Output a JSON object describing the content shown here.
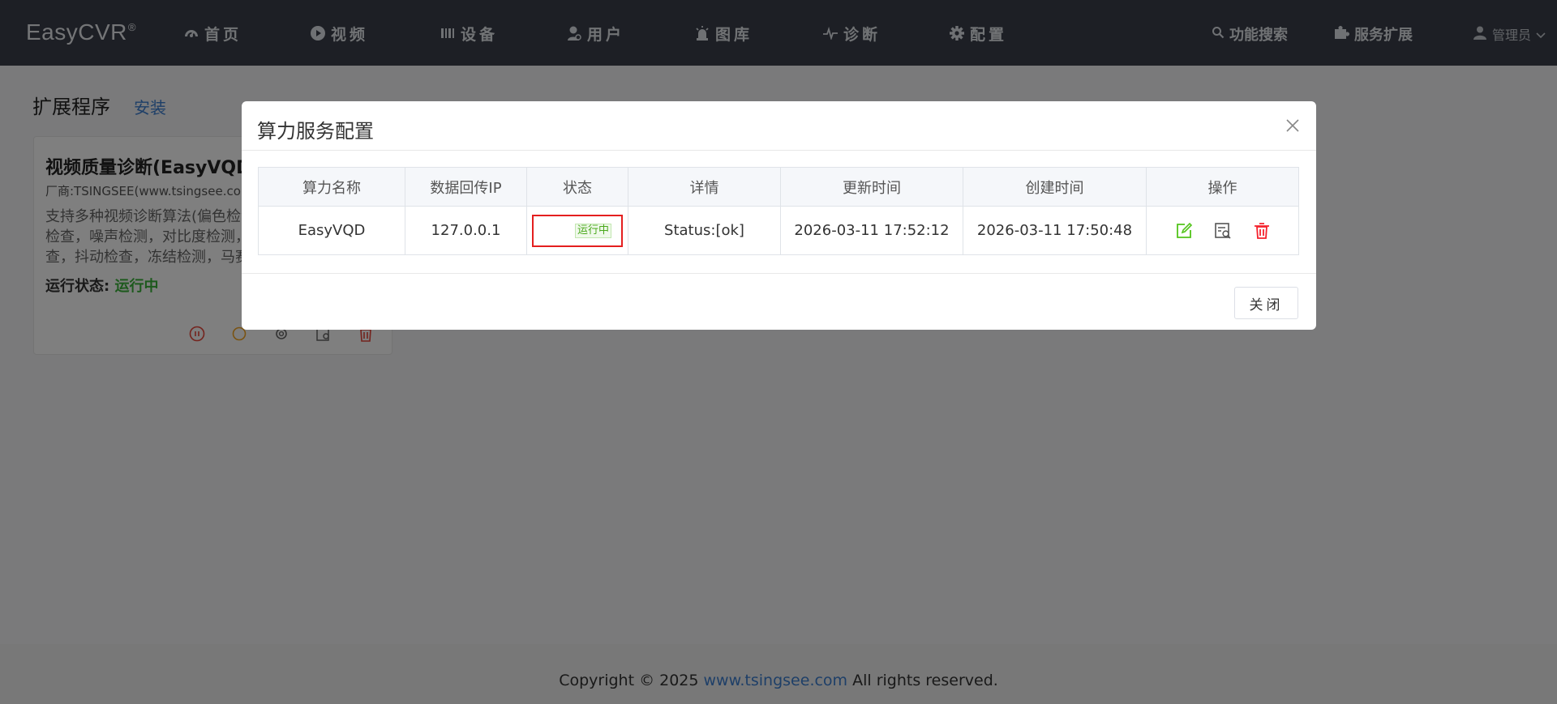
{
  "brand": {
    "name": "EasyCVR",
    "mark": "®"
  },
  "nav": {
    "items": [
      {
        "label": "首页",
        "icon": "dashboard-icon"
      },
      {
        "label": "视频",
        "icon": "play-circle-icon"
      },
      {
        "label": "设备",
        "icon": "device-rack-icon"
      },
      {
        "label": "用户",
        "icon": "user-gear-icon"
      },
      {
        "label": "图库",
        "icon": "alarm-light-icon"
      },
      {
        "label": "诊断",
        "icon": "pulse-icon"
      },
      {
        "label": "配置",
        "icon": "gear-icon"
      }
    ],
    "search_label": "功能搜索",
    "ext_label": "服务扩展",
    "user_label": "管理员"
  },
  "page": {
    "title": "扩展程序",
    "install_link": "安装"
  },
  "card": {
    "title": "视频质量诊断(EasyVQD",
    "vendor": "厂商:TSINGSEE(www.tsingsee.co",
    "desc_line1": "支持多种视频诊断算法(偏色检测",
    "desc_line2": "检查，噪声检测，对比度检测，",
    "desc_line3": "查，抖动检查，冻结检测，马赛",
    "status_label": "运行状态:",
    "status_value": "运行中"
  },
  "footer": {
    "prefix": "Copyright © 2025 ",
    "link": "www.tsingsee.com",
    "suffix": " All rights reserved."
  },
  "modal": {
    "title": "算力服务配置",
    "close_button": "关闭",
    "columns": [
      "算力名称",
      "数据回传IP",
      "状态",
      "详情",
      "更新时间",
      "创建时间",
      "操作"
    ],
    "rows": [
      {
        "name": "EasyVQD",
        "ip": "127.0.0.1",
        "status": "运行中",
        "detail": "Status:[ok]",
        "updated": "2026-03-11 17:52:12",
        "created": "2026-03-11 17:50:48"
      }
    ]
  },
  "colors": {
    "nav_bg": "#3a3f4b",
    "link": "#3d7fd0",
    "success": "#4aa91c",
    "danger": "#e41f1f",
    "edit_icon": "#52c41a",
    "delete_icon": "#f5222d"
  }
}
